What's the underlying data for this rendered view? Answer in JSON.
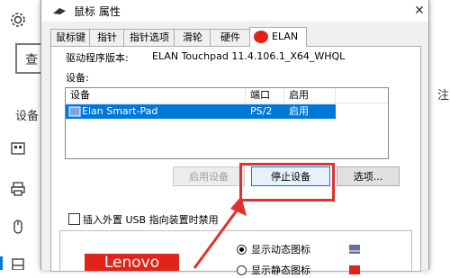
{
  "background_window": {
    "search_text": "查",
    "section_label": "设备",
    "right_fragment": "注"
  },
  "dialog": {
    "title": "鼠标 属性",
    "close_glyph": "✕",
    "tabs": [
      {
        "label": "鼠标键"
      },
      {
        "label": "指针"
      },
      {
        "label": "指针选项"
      },
      {
        "label": "滑轮"
      },
      {
        "label": "硬件"
      },
      {
        "label": "ELAN",
        "active": true
      }
    ],
    "driver_label": "驱动程序版本:",
    "driver_value": "ELAN Touchpad 11.4.106.1_X64_WHQL",
    "devices_label": "设备:",
    "device_table": {
      "columns": [
        "设备",
        "端口",
        "启用"
      ],
      "rows": [
        {
          "device": "Elan Smart-Pad",
          "port": "PS/2",
          "enabled": "启用",
          "selected": true
        }
      ]
    },
    "buttons": {
      "enable": "启用设备",
      "stop": "停止设备",
      "options": "选项..."
    },
    "disable_checkbox_label": "插入外置 USB 指向装置时禁用",
    "lenovo": {
      "logo_text": "Lenovo",
      "radio_dynamic": "显示动态图标",
      "radio_static": "显示静态图标"
    }
  },
  "colors": {
    "selection": "#0078d7",
    "highlight": "#e03030",
    "lenovo_red": "#e2231a"
  },
  "icons": [
    "gear-icon",
    "keyboard-icon",
    "printer-icon",
    "mouse-icon",
    "touchpad-icon",
    "mouse-title-icon",
    "elan-logo-icon",
    "arrow-annotation"
  ]
}
